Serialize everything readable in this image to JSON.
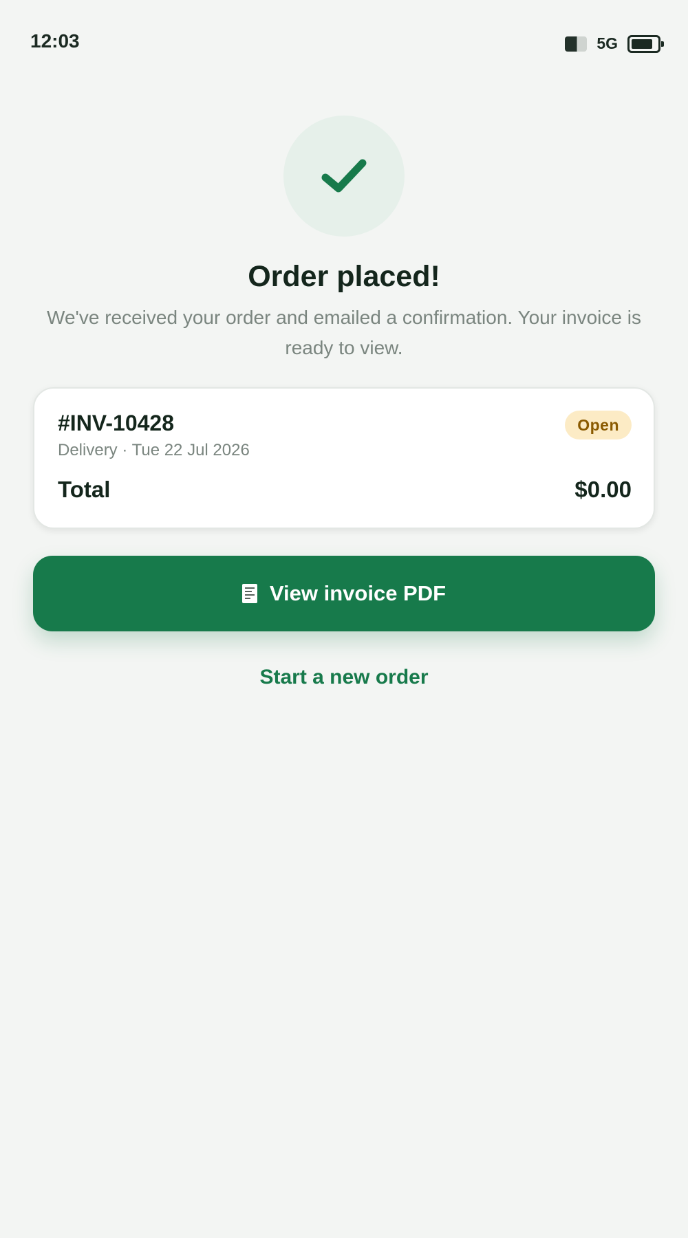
{
  "status_bar": {
    "time": "12:03",
    "network": "5G",
    "icons": [
      "signal-icon",
      "battery-icon"
    ]
  },
  "confirmation": {
    "icon": "checkmark-icon",
    "title": "Order placed!",
    "message": "We've received your order and emailed a confirmation. Your invoice is ready to view."
  },
  "invoice": {
    "number": "#INV-10428",
    "meta": "Delivery · Tue 22 Jul 2026",
    "status": "Open",
    "total_label": "Total",
    "total_value": "$0.00"
  },
  "actions": {
    "view_invoice_icon": "receipt-icon",
    "view_invoice_label": "View invoice PDF",
    "new_order_label": "Start a new order"
  },
  "colors": {
    "background": "#f3f5f3",
    "accent": "#177a4b",
    "badge_bg": "#fcebc5",
    "badge_text": "#8a5a00",
    "muted_text": "#7a857f"
  }
}
